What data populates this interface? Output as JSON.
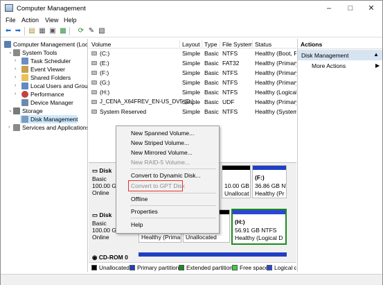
{
  "window": {
    "title": "Computer Management",
    "controls": {
      "minimize": "–",
      "maximize": "□",
      "close": "✕"
    }
  },
  "menu": [
    "File",
    "Action",
    "View",
    "Help"
  ],
  "toolbar": {
    "icons": [
      "back-arrow-icon",
      "forward-arrow-icon",
      "up-folder-icon",
      "properties-icon",
      "help-icon",
      "refresh-icon",
      "connect-icon",
      "settings-icon"
    ]
  },
  "tree": {
    "items": [
      {
        "label": "Computer Management (Local",
        "icon": "computer-management-icon",
        "color": "#5a7fb0"
      },
      {
        "label": "System Tools",
        "icon": "tools-icon",
        "color": "#8a8a8a"
      },
      {
        "label": "Task Scheduler",
        "icon": "task-scheduler-icon",
        "color": "#6b8fc4"
      },
      {
        "label": "Event Viewer",
        "icon": "event-viewer-icon",
        "color": "#c9a14a"
      },
      {
        "label": "Shared Folders",
        "icon": "shared-folders-icon",
        "color": "#e7c15a"
      },
      {
        "label": "Local Users and Groups",
        "icon": "users-icon",
        "color": "#5f89c7"
      },
      {
        "label": "Performance",
        "icon": "performance-icon",
        "color": "#c44141"
      },
      {
        "label": "Device Manager",
        "icon": "device-manager-icon",
        "color": "#6f8aa8"
      },
      {
        "label": "Storage",
        "icon": "storage-icon",
        "color": "#7a7a7a"
      },
      {
        "label": "Disk Management",
        "icon": "disk-management-icon",
        "color": "#7b9bbf"
      },
      {
        "label": "Services and Applications",
        "icon": "services-icon",
        "color": "#8a8a8a"
      }
    ]
  },
  "volumes": {
    "headers": [
      "Volume",
      "Layout",
      "Type",
      "File System",
      "Status"
    ],
    "rows": [
      {
        "volume": "(C:)",
        "layout": "Simple",
        "type": "Basic",
        "fs": "NTFS",
        "status": "Healthy (Boot, Pa"
      },
      {
        "volume": "(E:)",
        "layout": "Simple",
        "type": "Basic",
        "fs": "FAT32",
        "status": "Healthy (Primary"
      },
      {
        "volume": "(F:)",
        "layout": "Simple",
        "type": "Basic",
        "fs": "NTFS",
        "status": "Healthy (Primary"
      },
      {
        "volume": "(G:)",
        "layout": "Simple",
        "type": "Basic",
        "fs": "NTFS",
        "status": "Healthy (Primary"
      },
      {
        "volume": "(H:)",
        "layout": "Simple",
        "type": "Basic",
        "fs": "NTFS",
        "status": "Healthy (Logical"
      },
      {
        "volume": "J_CENA_X64FREV_EN-US_DV5 (D:)",
        "layout": "Simple",
        "type": "Basic",
        "fs": "UDF",
        "status": "Healthy (Primary"
      },
      {
        "volume": "System Reserved",
        "layout": "Simple",
        "type": "Basic",
        "fs": "NTFS",
        "status": "Healthy (System,"
      }
    ]
  },
  "disks": [
    {
      "name": "Disk",
      "type": "Basic",
      "size": "100.00 GB",
      "state": "Online"
    },
    {
      "name": "Disk",
      "type": "Basic",
      "size": "100.00 GB",
      "state": "Online"
    },
    {
      "name": "CD-ROM 0"
    }
  ],
  "partitions": {
    "disk0_unalloc": {
      "size": "10.00 GB",
      "label": "Unallocat"
    },
    "disk0_f": {
      "name": "(F:)",
      "size": "36.86 GB NTFS",
      "status": "Healthy (Pr"
    },
    "disk1_primary": {
      "status": "Healthy (Primar"
    },
    "disk1_unalloc": {
      "label": "Unallocated"
    },
    "disk1_h": {
      "name": "(H:)",
      "size": "56.91 GB NTFS",
      "status": "Healthy (Logical D"
    }
  },
  "legend": [
    {
      "label": "Unallocated",
      "color": "#000000"
    },
    {
      "label": "Primary partition",
      "color": "#1f3fc4"
    },
    {
      "label": "Extended partition",
      "color": "#1a8a1a"
    },
    {
      "label": "Free space",
      "color": "#3ccf3c"
    },
    {
      "label": "Logical d",
      "color": "#2b46d6"
    }
  ],
  "actions": {
    "header": "Actions",
    "section": "Disk Management",
    "more": "More Actions"
  },
  "context_menu": {
    "items": [
      {
        "label": "New Spanned Volume...",
        "disabled": false
      },
      {
        "label": "New Striped Volume...",
        "disabled": false
      },
      {
        "label": "New Mirrored Volume...",
        "disabled": false
      },
      {
        "label": "New RAID-5 Volume...",
        "disabled": true
      },
      {
        "label": "Convert to Dynamic Disk...",
        "disabled": false
      },
      {
        "label": "Convert to GPT Disk",
        "disabled": true
      },
      {
        "label": "Offline",
        "disabled": false
      },
      {
        "label": "Properties",
        "disabled": false
      },
      {
        "label": "Help",
        "disabled": false
      }
    ],
    "highlight_color": "#e0302e"
  }
}
